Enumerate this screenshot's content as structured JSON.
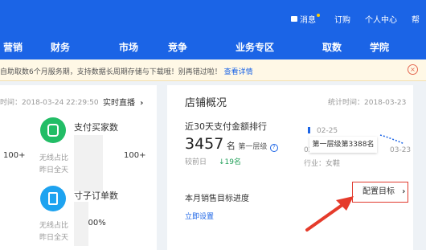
{
  "header": {
    "links": [
      "消息",
      "订购",
      "个人中心",
      "帮"
    ],
    "nav": [
      "营销",
      "财务",
      "市场",
      "竞争",
      "业务专区",
      "取数",
      "学院"
    ]
  },
  "notice": {
    "text": "自助取数6个月服务期，支持数据长周期存储与下载哦！别再错过啦！",
    "link": "查看详情",
    "close": "×"
  },
  "left_card": {
    "time": "时间：2018-03-24 22:29:50",
    "live": "实时直播",
    "live_arrow": "›",
    "buyers_title": "支付买家数",
    "left_val": "100+",
    "right_val": "100+",
    "compare_label": "无线占比",
    "yesterday": "昨日全天",
    "orders_title": "寸子订单数",
    "compare_label2": "无线占比",
    "pct": "0.00%",
    "yesterday2": "昨日全天"
  },
  "right_card": {
    "title": "店铺概况",
    "stat_time": "统计时间：2018-03-23",
    "ranking_title": "近30天支付金额排行",
    "rank_value": "3457",
    "rank_unit": "名",
    "tier": "第一层级",
    "q": "?",
    "prev_label": "较前日",
    "prev_change": "↓19名",
    "date_left": "02-25",
    "date_right": "03-23",
    "date_left_bottom": "02-25",
    "tooltip": "第一层级第3388名",
    "industry": "行业：女鞋",
    "target_title": "本月销售目标进度",
    "setup_link": "立即设置",
    "config_label": "配置目标",
    "config_arrow": "›"
  },
  "colors": {
    "primary": "#1b64e6",
    "accent_red": "#e03b2f",
    "green": "#22bd66",
    "blue": "#1ea3f0",
    "notice_bg": "#fff8e6"
  }
}
